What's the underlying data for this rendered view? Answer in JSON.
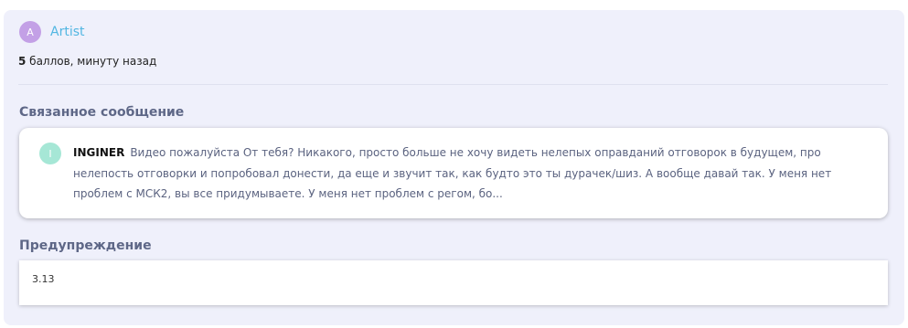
{
  "post": {
    "avatar_letter": "A",
    "author": "Artist",
    "points": "5",
    "points_suffix": " баллов, минуту назад"
  },
  "related_message": {
    "section_title": "Связанное сообщение",
    "avatar_letter": "I",
    "author": "INGINER",
    "text": "Видео пожалуйста От тебя? Никакого, просто больше не хочу видеть нелепых оправданий отговорок в будущем, про нелепость отговорки и попробовал донести, да еще и звучит так, как будто это ты дурачек/шиз. А вообще давай так. У меня нет проблем с МСК2, вы все придумываете. У меня нет проблем с регом, бо..."
  },
  "warning": {
    "section_title": "Предупреждение",
    "value": "3.13"
  },
  "colors": {
    "card_background": "#eff0fb",
    "author_link": "#52b6e2",
    "section_title": "#5e6787",
    "avatar_artist": "#c3a0e6",
    "avatar_inginer": "#a6e7d6"
  }
}
